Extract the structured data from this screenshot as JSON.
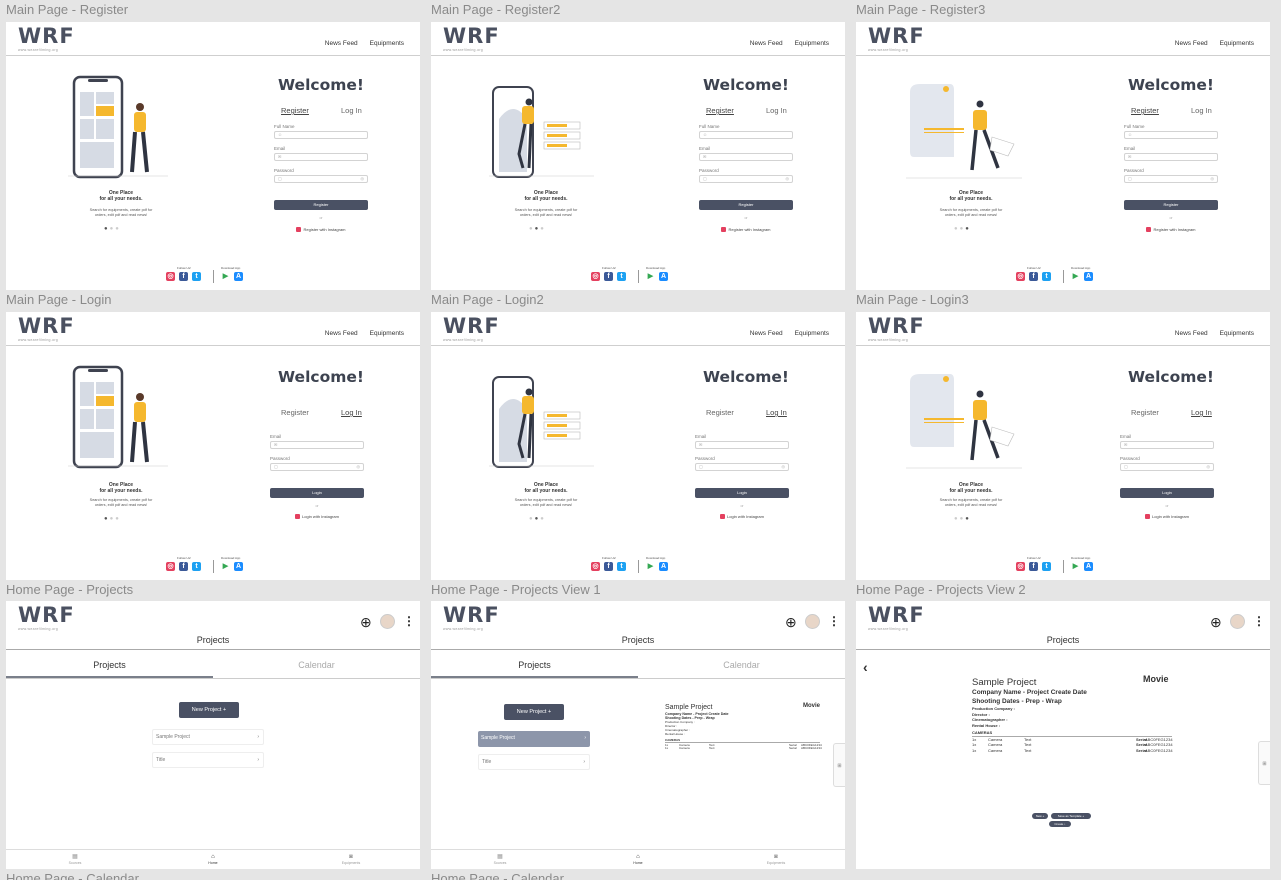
{
  "boards": {
    "r1": [
      "Main Page - Register",
      "Main Page - Register2",
      "Main Page - Register3"
    ],
    "r2": [
      "Main Page - Login",
      "Main Page - Login2",
      "Main Page - Login3"
    ],
    "r3": [
      "Home Page - Projects",
      "Home Page - Projects View 1",
      "Home Page - Projects View 2"
    ],
    "r4": [
      "Home Page - Calendar",
      "Home Page - Calendar"
    ]
  },
  "brand": {
    "logo": "WRF",
    "tagline": "www.wearefilming.org"
  },
  "nav": {
    "news_feed": "News Feed",
    "equipments": "Equipments"
  },
  "auth": {
    "welcome": "Welcome!",
    "register_tab": "Register",
    "login_tab": "Log In",
    "full_name_label": "Full Name",
    "email_label": "Email",
    "password_label": "Password",
    "register_button": "Register",
    "login_button": "Login",
    "or": "or",
    "register_instagram": "Register with Instagram",
    "login_instagram": "Login with Instagram",
    "eye_glyph": "◎",
    "lock_glyph": "🔒",
    "mail_glyph": "✉",
    "user_glyph": "☺"
  },
  "promo": {
    "title_1": "One Place",
    "title_2": "for all your needs.",
    "sub_1": "Search for equipments, create pdf for",
    "sub_2": "orders, edit pdf and read news!"
  },
  "footer": {
    "follow_us": "Follow Us!",
    "download_app": "Download App",
    "download_app_alt": "Download App"
  },
  "home": {
    "title": "Projects",
    "tab_projects": "Projects",
    "tab_calendar": "Calendar",
    "new_project": "New Project  +",
    "projects": [
      "Sample Project",
      "Title"
    ],
    "chevron": "›",
    "nav_labels": [
      "Sources",
      "Home",
      "Equipments"
    ],
    "side_tab": "⊞"
  },
  "project_detail": {
    "name": "Sample Project",
    "type": "Movie",
    "line1": "Company Name - Project Create Date",
    "line2": "Shooting Dates - Prep - Wrap",
    "production_company": "Production Company :",
    "director": "Director :",
    "cinematographer": "Cinematographer :",
    "rental_house": "Rental House :",
    "section": "CAMERAS",
    "rows": [
      {
        "qty": "1x",
        "item": "Camera",
        "text": "Text",
        "serial_label": "Serial",
        "serial": "ABC0FEG1234"
      },
      {
        "qty": "1x",
        "item": "Camera",
        "text": "Text",
        "serial_label": "Serial",
        "serial": "ABC0FEG1234"
      },
      {
        "qty": "1x",
        "item": "Camera",
        "text": "Text",
        "serial_label": "Serial",
        "serial": "ABC0FEG1234"
      }
    ],
    "pill_new": "New +",
    "pill_template": "Save as Template +",
    "pill_create": "Create ↓"
  },
  "colors": {
    "accent": "#4a5164",
    "illustration_yellow": "#f5b82e",
    "panel": "#ffffff",
    "canvas": "#e5e5e5"
  }
}
